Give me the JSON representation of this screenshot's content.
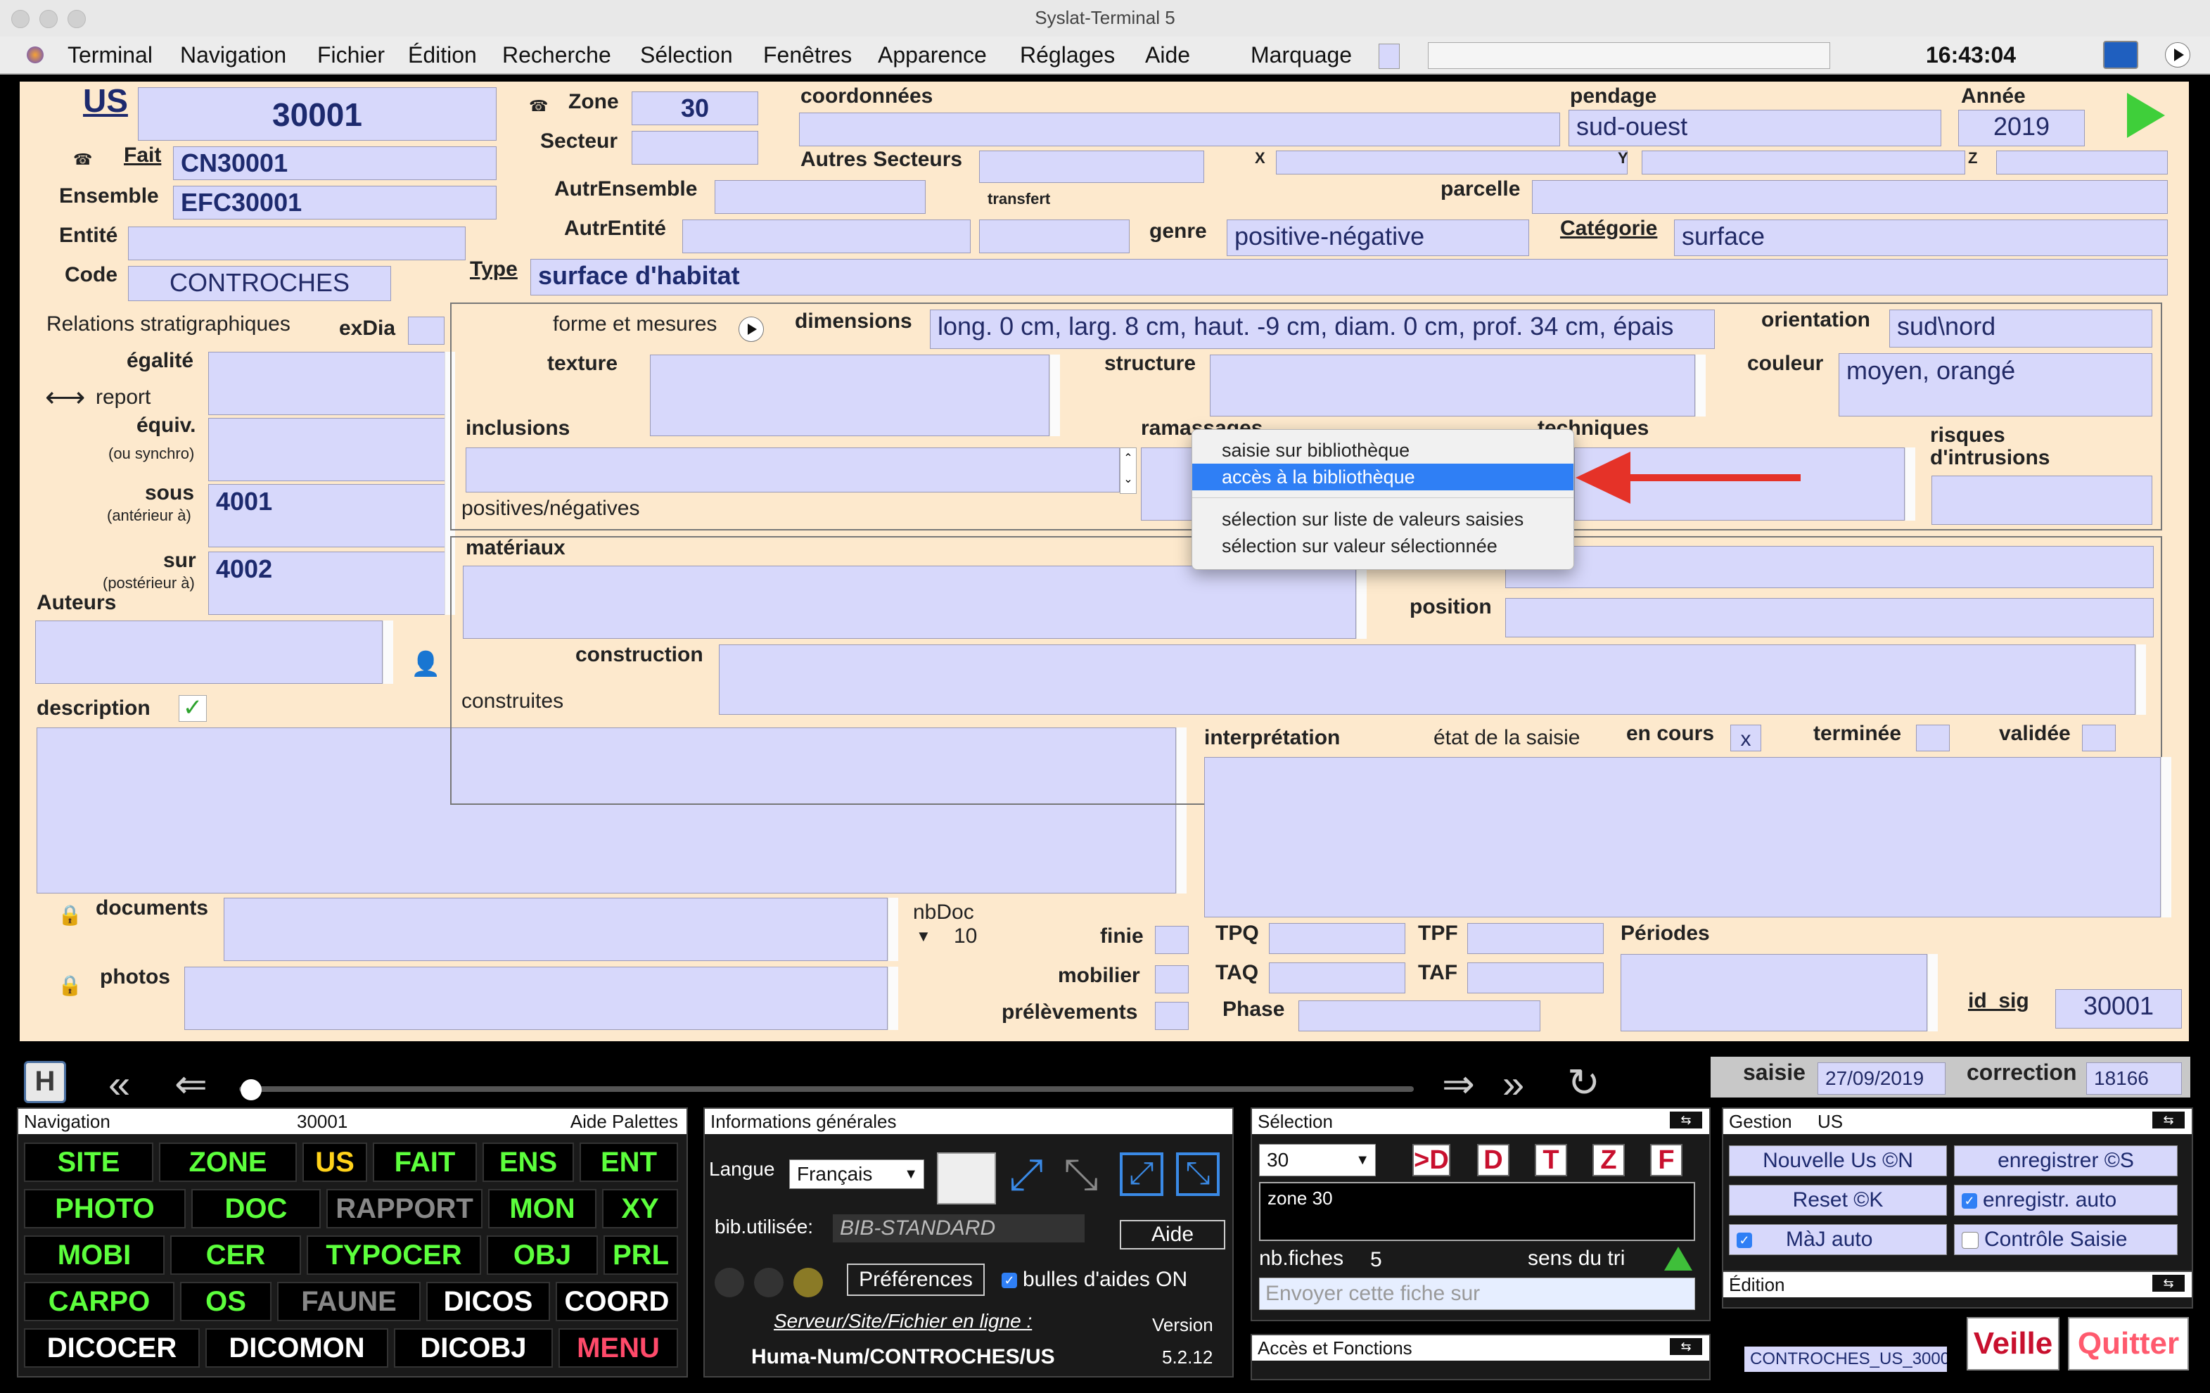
{
  "window": {
    "title": "Syslat-Terminal 5"
  },
  "menubar": {
    "items": [
      "Terminal",
      "Navigation",
      "Fichier",
      "Édition",
      "Recherche",
      "Sélection",
      "Fenêtres",
      "Apparence",
      "Réglages",
      "Aide"
    ],
    "marquage": "Marquage",
    "clock": "16:43:04"
  },
  "form": {
    "us_label": "US",
    "us_value": "30001",
    "zone_label": "Zone",
    "zone_value": "30",
    "secteur_label": "Secteur",
    "coordonnees_label": "coordonnées",
    "pendage_label": "pendage",
    "pendage_value": "sud-ouest",
    "annee_label": "Année",
    "annee_value": "2019",
    "fait_label": "Fait",
    "fait_value": "CN30001",
    "autres_secteurs_label": "Autres Secteurs",
    "x_label": "X",
    "y_label": "Y",
    "z_label": "Z",
    "ensemble_label": "Ensemble",
    "ensemble_value": "EFC30001",
    "autrensemble_label": "AutrEnsemble",
    "transfert_label": "transfert",
    "parcelle_label": "parcelle",
    "entite_label": "Entité",
    "autrentite_label": "AutrEntité",
    "genre_label": "genre",
    "genre_value": "positive-négative",
    "categorie_label": "Catégorie",
    "categorie_value": "surface",
    "code_label": "Code",
    "code_value": "CONTROCHES",
    "type_label": "Type",
    "type_value": "surface d'habitat",
    "relations_label": "Relations stratigraphiques",
    "exdia_label": "exDia",
    "egalite_label": "égalité",
    "report_label": "report",
    "equiv_label": "équiv.",
    "equiv_sub": "(ou synchro)",
    "sous_label": "sous",
    "sous_sub": "(antérieur à)",
    "sous_value": "4001",
    "sur_label": "sur",
    "sur_sub": "(postérieur à)",
    "sur_value": "4002",
    "auteurs_label": "Auteurs",
    "description_label": "description",
    "forme_label": "forme et mesures",
    "dimensions_label": "dimensions",
    "dimensions_value": "long. 0 cm, larg. 8 cm, haut. -9 cm, diam. 0 cm, prof. 34 cm, épais",
    "orientation_label": "orientation",
    "orientation_value": "sud\\nord",
    "texture_label": "texture",
    "structure_label": "structure",
    "couleur_label": "couleur",
    "couleur_value": "moyen, orangé",
    "inclusions_label": "inclusions",
    "ramassages_label": "ramassages",
    "techniques_label": "techniques",
    "risques_label": "risques",
    "intrusions_label": "d'intrusions",
    "positives_label": "positives/négatives",
    "materiaux_label": "matériaux",
    "position_label": "position",
    "construction_label": "construction",
    "construites_label": "construites",
    "interpretation_label": "interprétation",
    "etat_label": "état de la saisie",
    "en_cours_label": "en cours",
    "en_cours_value": "x",
    "terminee_label": "terminée",
    "validee_label": "validée",
    "documents_label": "documents",
    "photos_label": "photos",
    "nbdoc_label": "nbDoc",
    "nbdoc_value": "10",
    "finie_label": "finie",
    "mobilier_label": "mobilier",
    "prelevements_label": "prélèvements",
    "tpq_label": "TPQ",
    "tpf_label": "TPF",
    "taq_label": "TAQ",
    "taf_label": "TAF",
    "phase_label": "Phase",
    "periodes_label": "Périodes",
    "idsig_label": "id_sig",
    "idsig_value": "30001"
  },
  "context_menu": {
    "items": [
      "saisie sur bibliothèque",
      "accès à la bibliothèque",
      "sélection sur liste de valeurs saisies",
      "sélection sur valeur sélectionnée"
    ],
    "selected_index": 1
  },
  "statusbar": {
    "saisie_label": "saisie",
    "saisie_value": "27/09/2019",
    "correction_label": "correction",
    "correction_value": "18166"
  },
  "nav_panel": {
    "title": "Navigation",
    "record": "30001",
    "aide": "Aide Palettes",
    "rows": [
      [
        "SITE",
        "ZONE",
        "US",
        "FAIT",
        "ENS",
        "ENT"
      ],
      [
        "PHOTO",
        "DOC",
        "RAPPORT",
        "MON",
        "XY"
      ],
      [
        "MOBI",
        "CER",
        "TYPOCER",
        "OBJ",
        "PRL"
      ],
      [
        "CARPO",
        "OS",
        "FAUNE",
        "DICOS",
        "COORD"
      ],
      [
        "DICOCER",
        "DICOMON",
        "DICOBJ",
        "MENU"
      ]
    ]
  },
  "info_panel": {
    "title": "Informations générales",
    "langue_label": "Langue",
    "langue_value": "Français",
    "bib_label": "bib.utilisée:",
    "bib_value": "BIB-STANDARD",
    "aide": "Aide",
    "preferences": "Préférences",
    "bulles": "bulles d'aides ON",
    "serveur": "Serveur/Site/Fichier en ligne :",
    "version_label": "Version",
    "path": "Huma-Num/CONTROCHES/US",
    "version_value": "5.2.12"
  },
  "selection_panel": {
    "title": "Sélection",
    "zone_value": "30",
    "buttons": [
      ">D",
      "D",
      "T",
      "Z",
      "F"
    ],
    "list_value": "zone 30",
    "nbfiches_label": "nb.fiches",
    "nbfiches_value": "5",
    "tri_label": "sens du tri",
    "envoyer_placeholder": "Envoyer cette fiche sur",
    "acces_title": "Accès et Fonctions"
  },
  "gestion_panel": {
    "title": "Gestion",
    "title_value": "US",
    "nouvelle": "Nouvelle Us ©N",
    "enregistrer": "enregistrer ©S",
    "reset": "Reset ©K",
    "enregistr_auto": "enregistr. auto",
    "maj_auto": "MàJ auto",
    "controle": "Contrôle Saisie",
    "edition_title": "Édition",
    "veille": "Veille",
    "quitter": "Quitter",
    "footer": "CONTROCHES_US_3000"
  },
  "colors": {
    "form_bg": "#fde9cd",
    "field_bg": "#d7d8fb",
    "accent_green": "#5cff3c",
    "arrow_red": "#e53228"
  }
}
